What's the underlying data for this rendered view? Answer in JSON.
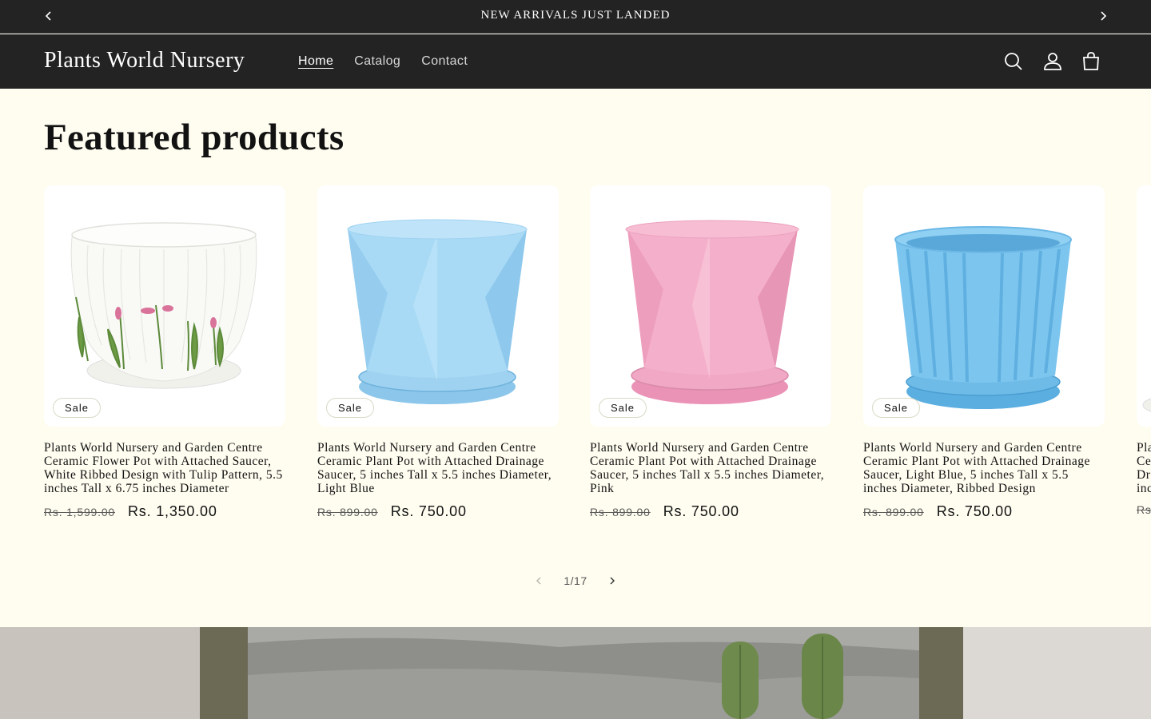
{
  "announcement": {
    "text": "NEW ARRIVALS JUST LANDED"
  },
  "header": {
    "logo": "Plants World Nursery",
    "nav": [
      {
        "label": "Home",
        "active": true
      },
      {
        "label": "Catalog",
        "active": false
      },
      {
        "label": "Contact",
        "active": false
      }
    ],
    "icons": [
      "search-icon",
      "account-icon",
      "cart-icon"
    ]
  },
  "featured": {
    "title": "Featured products",
    "products": [
      {
        "title": "Plants World Nursery and Garden Centre Ceramic Flower Pot with Attached Saucer, White Ribbed Design with Tulip Pattern, 5.5 inches Tall x 6.75 inches Diameter",
        "badge": "Sale",
        "old_price": "Rs. 1,599.00",
        "new_price": "Rs. 1,350.00",
        "color": "#ffffff"
      },
      {
        "title": "Plants World Nursery and Garden Centre Ceramic Plant Pot with Attached Drainage Saucer, 5 inches Tall x 5.5 inches Diameter, Light Blue",
        "badge": "Sale",
        "old_price": "Rs. 899.00",
        "new_price": "Rs. 750.00",
        "color": "#a8d8f5"
      },
      {
        "title": "Plants World Nursery and Garden Centre Ceramic Plant Pot with Attached Drainage Saucer, 5 inches Tall x 5.5 inches Diameter, Pink",
        "badge": "Sale",
        "old_price": "Rs. 899.00",
        "new_price": "Rs. 750.00",
        "color": "#f2a9c6"
      },
      {
        "title": "Plants World Nursery and Garden Centre Ceramic Plant Pot with Attached Drainage Saucer, Light Blue, 5 inches Tall x 5.5 inches Diameter, Ribbed Design",
        "badge": "Sale",
        "old_price": "Rs. 899.00",
        "new_price": "Rs. 750.00",
        "color": "#7ec6ef"
      }
    ],
    "partial_card": {
      "title_lines": [
        "Pla",
        "Ce",
        "Dr",
        "inc"
      ],
      "old_price": "Rs"
    },
    "pager": {
      "text": "1/17"
    }
  }
}
